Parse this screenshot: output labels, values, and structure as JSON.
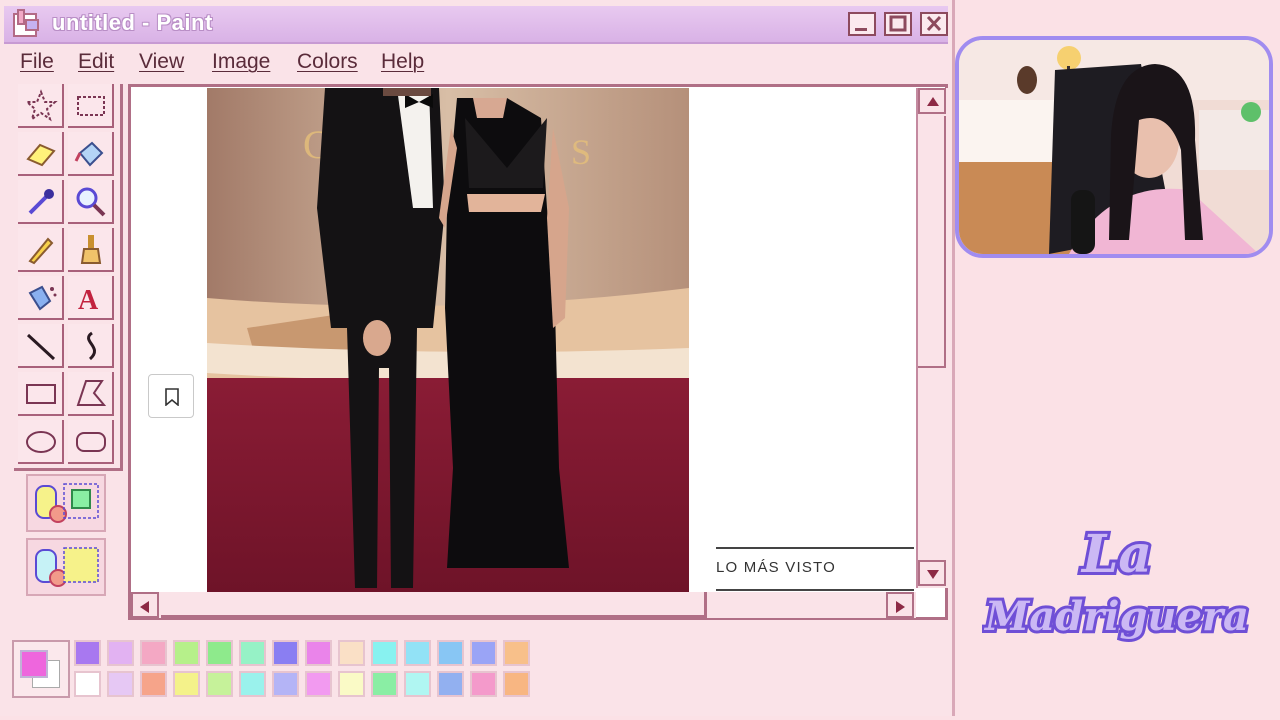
{
  "window": {
    "title": "untitled - Paint",
    "menu": [
      "File",
      "Edit",
      "View",
      "Image",
      "Colors",
      "Help"
    ]
  },
  "toolbox": {
    "tools": [
      "free-form-select",
      "rect-select",
      "eraser",
      "fill",
      "color-picker",
      "magnifier",
      "pencil",
      "brush",
      "airbrush",
      "text",
      "line",
      "curve",
      "rectangle",
      "polygon",
      "ellipse",
      "rounded-rectangle"
    ]
  },
  "canvas": {
    "overlay_label": "LO MÁS VISTO"
  },
  "palette": {
    "foreground": "#ee66dd",
    "background": "#ffffff",
    "colors_top": [
      "#a878f0",
      "#e2b2f2",
      "#f4a8c4",
      "#b6f08a",
      "#8eea8c",
      "#96f2c6",
      "#8a7ef2",
      "#ea84ea",
      "#fae0c6",
      "#88f2f0",
      "#92e2f6",
      "#88c6f4",
      "#9aa4f6",
      "#f8c08a"
    ],
    "colors_bottom": [
      "#ffffff",
      "#e6c8f4",
      "#f6a48a",
      "#f4f28a",
      "#c6f29a",
      "#9af2ec",
      "#b4b4f6",
      "#f29af0",
      "#fafac6",
      "#8aeea4",
      "#b0f6f2",
      "#92b0f0",
      "#f49acb",
      "#f8b682"
    ]
  },
  "branding": {
    "logo_text": "La Madriguera"
  },
  "colors": {
    "accent": "#b06f86",
    "title_bar": "#d9b2e6",
    "webcam_border": "#a08cf0",
    "background": "#fbe1e6"
  }
}
